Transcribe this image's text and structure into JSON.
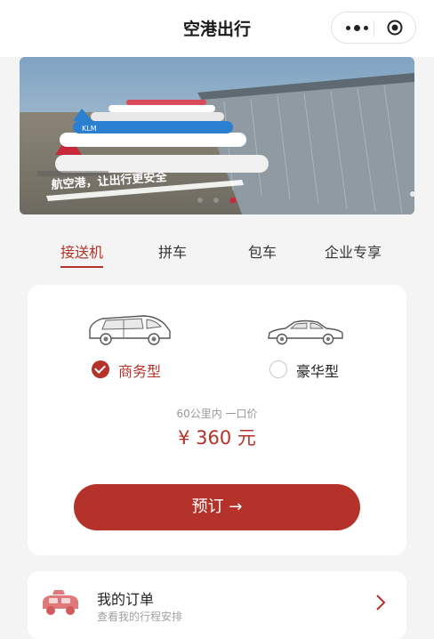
{
  "app": {
    "title": "空港出行"
  },
  "navbar": {
    "more_icon": "more-dots-icon",
    "close_icon": "target-icon"
  },
  "banner": {
    "slogan": "航空港，让出行更安全",
    "airline_text": "KLM",
    "slides_total": 3,
    "active_slide": 3
  },
  "tabs": [
    {
      "label": "接送机",
      "active": true
    },
    {
      "label": "拼车",
      "active": false
    },
    {
      "label": "包车",
      "active": false
    },
    {
      "label": "企业专享",
      "active": false
    }
  ],
  "service": {
    "options": [
      {
        "label": "商务型",
        "selected": true,
        "icon": "van-icon"
      },
      {
        "label": "豪华型",
        "selected": false,
        "icon": "sedan-icon"
      }
    ],
    "price_note": "60公里内 一口价",
    "price": "¥ 360 元",
    "book_label": "预订 →"
  },
  "orders": {
    "title": "我的订单",
    "subtitle": "查看我的行程安排",
    "icon": "car-icon"
  },
  "colors": {
    "accent": "#b5322a",
    "background": "#f4f4f4"
  }
}
